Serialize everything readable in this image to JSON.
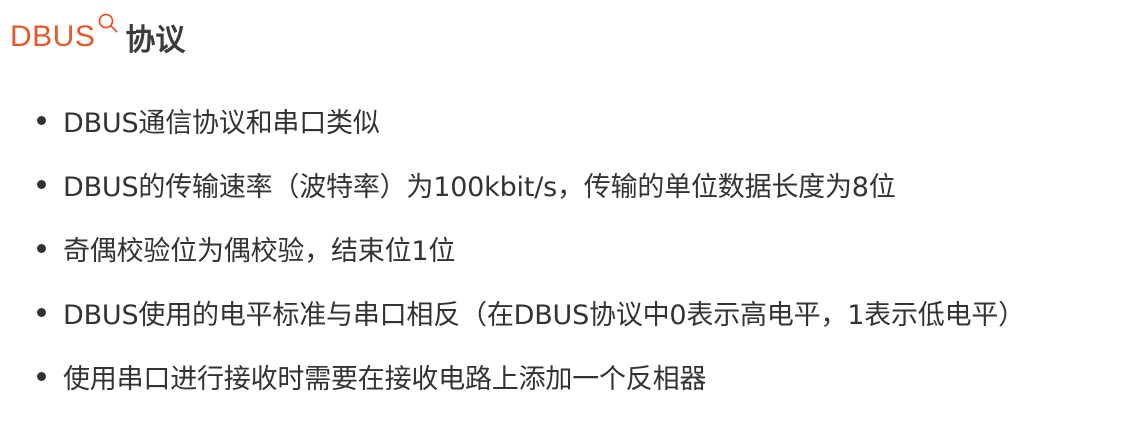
{
  "heading": {
    "prefix": "DBUS",
    "main": "协议",
    "icon": "search-icon",
    "accent_color": "#e8572c"
  },
  "bullets": [
    "DBUS通信协议和串口类似",
    "DBUS的传输速率（波特率）为100kbit/s，传输的单位数据长度为8位",
    "奇偶校验位为偶校验，结束位1位",
    "DBUS使用的电平标准与串口相反（在DBUS协议中0表示高电平，1表示低电平）",
    "使用串口进行接收时需要在接收电路上添加一个反相器"
  ]
}
